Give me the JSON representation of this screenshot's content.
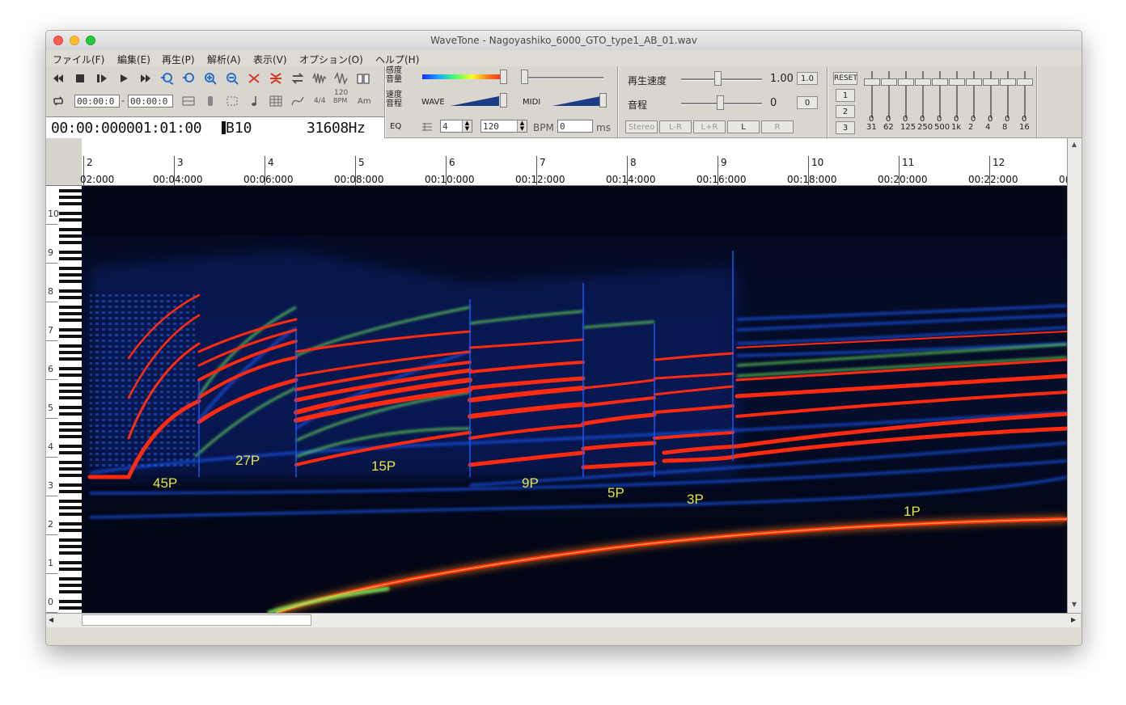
{
  "window": {
    "title": "WaveTone - Nagoyashiko_6000_GTO_type1_AB_01.wav"
  },
  "menu": [
    {
      "label": "ファイル(F)"
    },
    {
      "label": "編集(E)"
    },
    {
      "label": "再生(P)"
    },
    {
      "label": "解析(A)"
    },
    {
      "label": "表示(V)"
    },
    {
      "label": "オプション(O)"
    },
    {
      "label": "ヘルプ(H)"
    }
  ],
  "toolbar": {
    "time_start": "00:00:0",
    "time_end": "00:00:0",
    "time_sep": "-",
    "meter_label": "4/4",
    "bpm_icon_top": "120",
    "bpm_icon_bottom": "BPM",
    "key_label": "Am",
    "position_display": "00:00:000001:01:00",
    "note_display": "B10",
    "freq_display": "31608Hz",
    "eq_label": "EQ",
    "sens_top": "感度",
    "sens_bottom": "音量",
    "speed_top": "速度",
    "speed_bottom": "音程",
    "wave_label": "WAVE",
    "midi_label": "MIDI",
    "beats_value": "4",
    "tempo_value": "120",
    "bpm_label": "BPM",
    "ms_value": "0",
    "ms_label": "ms",
    "playback_speed_label": "再生速度",
    "playback_speed_value": "1.00",
    "playback_speed_reset": "1.0",
    "pitch_label": "音程",
    "pitch_value": "0",
    "pitch_reset": "0",
    "channel_buttons": [
      "Stereo",
      "L-R",
      "L+R",
      "L",
      "R"
    ],
    "reset_label": "RESET",
    "preset_buttons": [
      "1",
      "2",
      "3"
    ],
    "eq_values": [
      "0",
      "0",
      "0",
      "0",
      "0",
      "0",
      "0",
      "0",
      "0",
      "0"
    ],
    "eq_bands": [
      "31",
      "62",
      "125",
      "250",
      "500",
      "1k",
      "2",
      "4",
      "8",
      "16"
    ]
  },
  "ruler": {
    "measures": [
      "2",
      "3",
      "4",
      "5",
      "6",
      "7",
      "8",
      "9",
      "10",
      "11",
      "12"
    ],
    "times": [
      "02:000",
      "00:04:000",
      "00:06:000",
      "00:08:000",
      "00:10:000",
      "00:12:000",
      "00:14:000",
      "00:16:000",
      "00:18:000",
      "00:20:000",
      "00:22:000",
      "0("
    ]
  },
  "keyboard": {
    "octaves": [
      "10",
      "9",
      "8",
      "7",
      "6",
      "5",
      "4",
      "3",
      "2",
      "1",
      "0"
    ]
  },
  "spectrogram": {
    "annotations": [
      "45P",
      "27P",
      "15P",
      "9P",
      "5P",
      "3P",
      "1P"
    ],
    "colors": {
      "background": "#020616",
      "strong": "#ff2a10",
      "mid": "#7cff5a",
      "weak": "#1f5bff"
    }
  }
}
